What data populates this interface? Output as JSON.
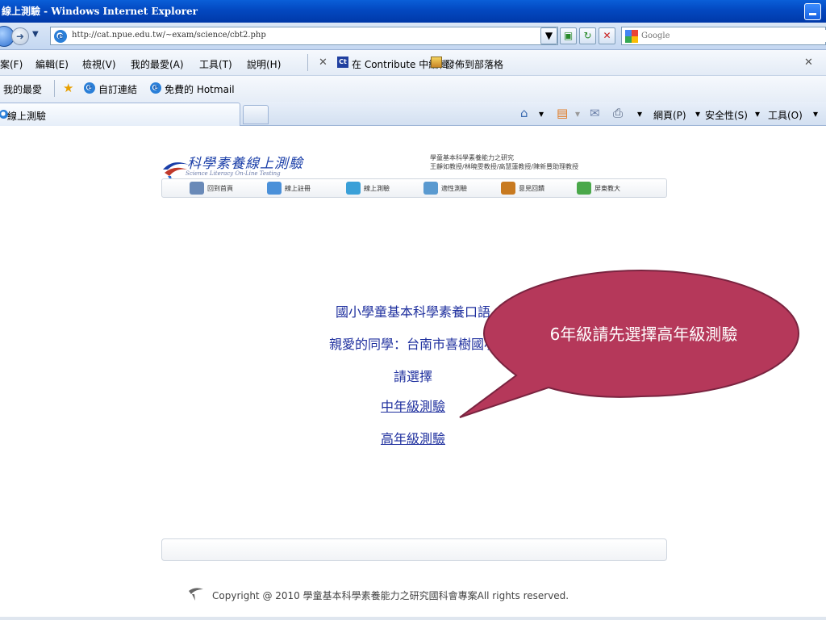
{
  "window": {
    "title": "線上測驗 - Windows Internet Explorer"
  },
  "address": {
    "url": "http://cat.npue.edu.tw/~exam/science/cbt2.php",
    "search_placeholder": "Google"
  },
  "menu": {
    "items": [
      "案(F)",
      "編輯(E)",
      "檢視(V)",
      "我的最愛(A)",
      "工具(T)",
      "說明(H)"
    ],
    "contribute": "在 Contribute 中編輯",
    "publish_blog": "發佈到部落格"
  },
  "favorites": {
    "label": "我的最愛",
    "links": [
      "自訂連結",
      "免費的 Hotmail"
    ]
  },
  "tabs": {
    "active": "線上測驗"
  },
  "commands": {
    "page": "網頁(P)",
    "safety": "安全性(S)",
    "tools": "工具(O)"
  },
  "site": {
    "logo": "科學素養線上測驗",
    "subtitle": "Science Literacy On-Line Testing",
    "project_line1": "學童基本科學素養能力之研究",
    "project_line2": "王靜如教授/林曉雯教授/高慧蓮教授/陳新豐助理教授",
    "nav": [
      {
        "label": "回到首頁",
        "icon": "home-icon",
        "color": "#6a8ab8"
      },
      {
        "label": "線上註冊",
        "icon": "register-icon",
        "color": "#4a90d9"
      },
      {
        "label": "線上測驗",
        "icon": "test-icon",
        "color": "#3aa0d8"
      },
      {
        "label": "適性測驗",
        "icon": "adaptive-icon",
        "color": "#5a9ad0"
      },
      {
        "label": "意見回饋",
        "icon": "feedback-icon",
        "color": "#c87a20"
      },
      {
        "label": "屏東教大",
        "icon": "university-icon",
        "color": "#4aa84a"
      }
    ]
  },
  "content": {
    "title": "國小學童基本科學素養口語",
    "greeting": "親愛的同學：台南市喜樹國小",
    "prompt": "請選擇",
    "link_mid": "中年級測驗",
    "link_high": "高年級測驗"
  },
  "callout": {
    "text": "6年級請先選擇高年級測驗",
    "color": "#b5385a"
  },
  "footer": {
    "copyright": "Copyright @ 2010 學童基本科學素養能力之研究國科會專案All rights reserved."
  }
}
